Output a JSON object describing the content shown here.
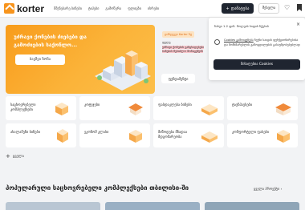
{
  "header": {
    "logo_text": "korter",
    "nav": [
      "მშენებარე ბინები",
      "ტიპები",
      "გამოწერა",
      "ფლიცზი",
      "ისრები"
    ],
    "add_button": "დამატება",
    "login_button": "შესვლა"
  },
  "hero": {
    "title": "უძრავი ქონების ძიებები და გამოძიების საქონლო...",
    "button": "ბავშვი ზონა"
  },
  "feature": {
    "tag": "დაზღვევა Korter ნტ",
    "text_1": "ფულე",
    "text_2": "უძრავი ქონების განცხადებები ბინების შესაძლო მონაცემებს",
    "link": "ფუნდამენტი"
  },
  "cookie": {
    "date": "ნახვა 1.2 ფინ. მოლეის სიფიხ ნქების",
    "text_link1": "Cookies გამოიყენება",
    "text_rest": "ჩვენი საიტის ფუნქციონირებისა და მომხმარებლის გამოცდილების გასაუმჯობესებლად",
    "button": "მისაღებია Cookies",
    "close": "×"
  },
  "categories": [
    {
      "label": "საცხოვრებელი კომპლექსები"
    },
    {
      "label": "კოტეჯები"
    },
    {
      "label": "ფასდაკლება ბინები"
    },
    {
      "label": "ტაუნჰაუსები"
    },
    {
      "label": "ახალაშენი ბინები"
    },
    {
      "label": "ეკონომ კლასი"
    },
    {
      "label": "მიწოდება მზადაა მდგომარეობა"
    },
    {
      "label": "კომფორტული ფასები"
    }
  ],
  "more": "ყველა",
  "section": {
    "title": "პოპულარული საცხოვრებელი კომპლექსები თბილისი-ში",
    "see_all": "ყველა პროექტი ›"
  },
  "colors": {
    "accent": "#f7941d",
    "dark": "#1f2530"
  }
}
